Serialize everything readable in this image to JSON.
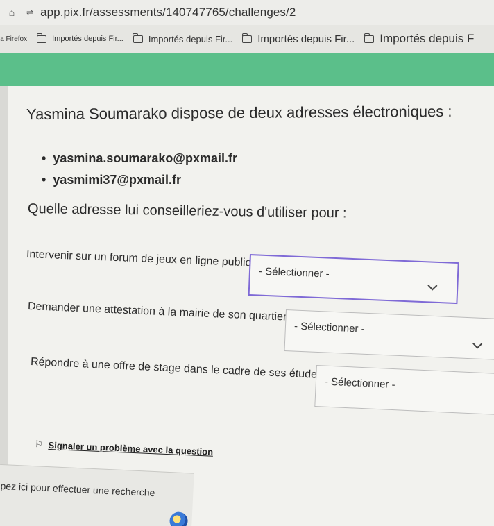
{
  "browser": {
    "url": "app.pix.fr/assessments/140747765/challenges/2",
    "bookmarks": [
      "la Firefox",
      "Importés depuis Fir...",
      "Importés depuis Fir...",
      "Importés depuis Fir...",
      "Importés depuis F"
    ]
  },
  "challenge": {
    "intro": "Yasmina Soumarako dispose de deux adresses électroniques :",
    "emails": [
      "yasmina.soumarako@pxmail.fr",
      "yasmimi37@pxmail.fr"
    ],
    "question": "Quelle adresse lui conseilleriez-vous d'utiliser pour :",
    "items": [
      {
        "label": "Intervenir sur un forum de jeux en ligne public :",
        "value": "- Sélectionner -"
      },
      {
        "label": "Demander une attestation à la mairie de son quartier :",
        "value": "- Sélectionner -"
      },
      {
        "label": "Répondre à une offre de stage dans le cadre de ses études :",
        "value": "- Sélectionner -"
      }
    ],
    "report_link": "Signaler un problème avec la question"
  },
  "taskbar": {
    "search_placeholder": "pez ici pour effectuer une recherche"
  },
  "colors": {
    "accent_green": "#5bbf8a",
    "focus_purple": "#7f6ad6"
  }
}
